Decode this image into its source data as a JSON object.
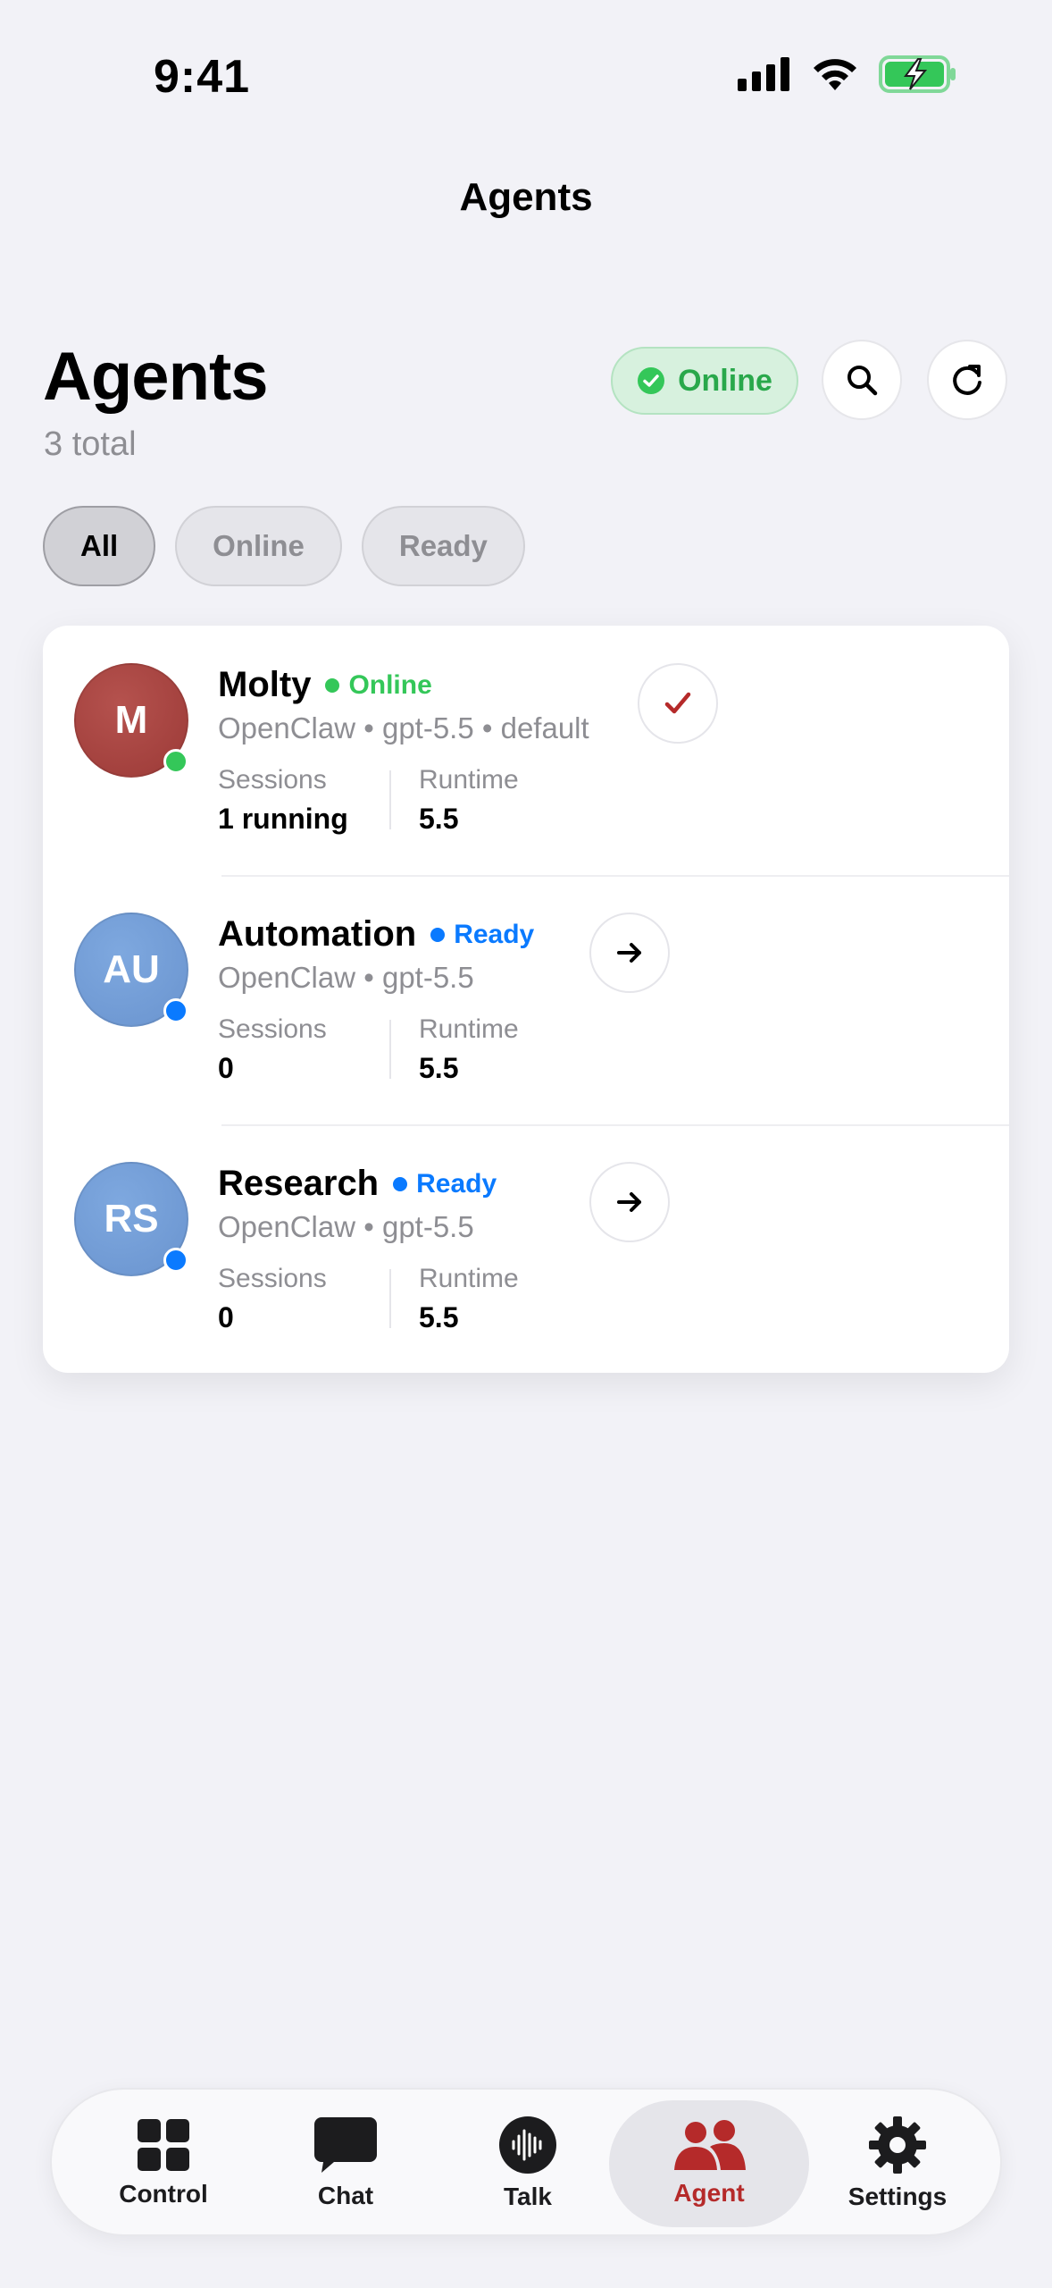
{
  "status_bar": {
    "time": "9:41"
  },
  "nav": {
    "title": "Agents"
  },
  "header": {
    "title": "Agents",
    "subtitle": "3 total",
    "online_pill": "Online"
  },
  "filters": [
    {
      "label": "All",
      "active": true
    },
    {
      "label": "Online",
      "active": false
    },
    {
      "label": "Ready",
      "active": false
    }
  ],
  "agents": [
    {
      "initials": "M",
      "name": "Molty",
      "status": "Online",
      "meta": "OpenClaw • gpt-5.5 • default",
      "sessions_label": "Sessions",
      "sessions_value": "1 running",
      "runtime_label": "Runtime",
      "runtime_value": "5.5",
      "action_icon": "checkmark-icon"
    },
    {
      "initials": "AU",
      "name": "Automation",
      "status": "Ready",
      "meta": "OpenClaw • gpt-5.5",
      "sessions_label": "Sessions",
      "sessions_value": "0",
      "runtime_label": "Runtime",
      "runtime_value": "5.5",
      "action_icon": "arrow-right-icon"
    },
    {
      "initials": "RS",
      "name": "Research",
      "status": "Ready",
      "meta": "OpenClaw • gpt-5.5",
      "sessions_label": "Sessions",
      "sessions_value": "0",
      "runtime_label": "Runtime",
      "runtime_value": "5.5",
      "action_icon": "arrow-right-icon"
    }
  ],
  "tabs": [
    {
      "label": "Control",
      "icon": "grid-icon"
    },
    {
      "label": "Chat",
      "icon": "chat-bubble-icon"
    },
    {
      "label": "Talk",
      "icon": "waveform-icon"
    },
    {
      "label": "Agent",
      "icon": "people-icon",
      "active": true
    },
    {
      "label": "Settings",
      "icon": "gear-icon"
    }
  ],
  "colors": {
    "background": "#f2f2f7",
    "online_green": "#34c759",
    "ready_blue": "#0a7aff",
    "accent_red": "#b52a2a",
    "molty_avatar": "#a9403d",
    "blue_avatar": "#6f9bd6"
  }
}
